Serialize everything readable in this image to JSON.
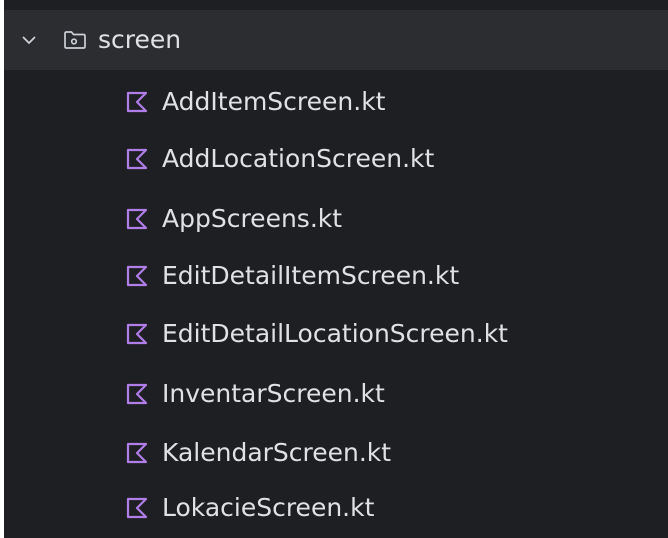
{
  "colors": {
    "background": "#1e1f22",
    "selected_row": "#2b2d30",
    "text": "#dfe1e5",
    "kotlin_icon": "#b07ee9",
    "folder_icon": "#cdd0d6"
  },
  "folder": {
    "label": "screen",
    "expanded": true,
    "icon": "folder-icon",
    "chevron": "chevron-down-icon"
  },
  "files": [
    {
      "label": "AddItemScreen.kt",
      "icon": "kotlin-file-icon"
    },
    {
      "label": "AddLocationScreen.kt",
      "icon": "kotlin-file-icon"
    },
    {
      "label": "AppScreens.kt",
      "icon": "kotlin-file-icon"
    },
    {
      "label": "EditDetailItemScreen.kt",
      "icon": "kotlin-file-icon"
    },
    {
      "label": "EditDetailLocationScreen.kt",
      "icon": "kotlin-file-icon"
    },
    {
      "label": "InventarScreen.kt",
      "icon": "kotlin-file-icon"
    },
    {
      "label": "KalendarScreen.kt",
      "icon": "kotlin-file-icon"
    },
    {
      "label": "LokacieScreen.kt",
      "icon": "kotlin-file-icon"
    }
  ]
}
